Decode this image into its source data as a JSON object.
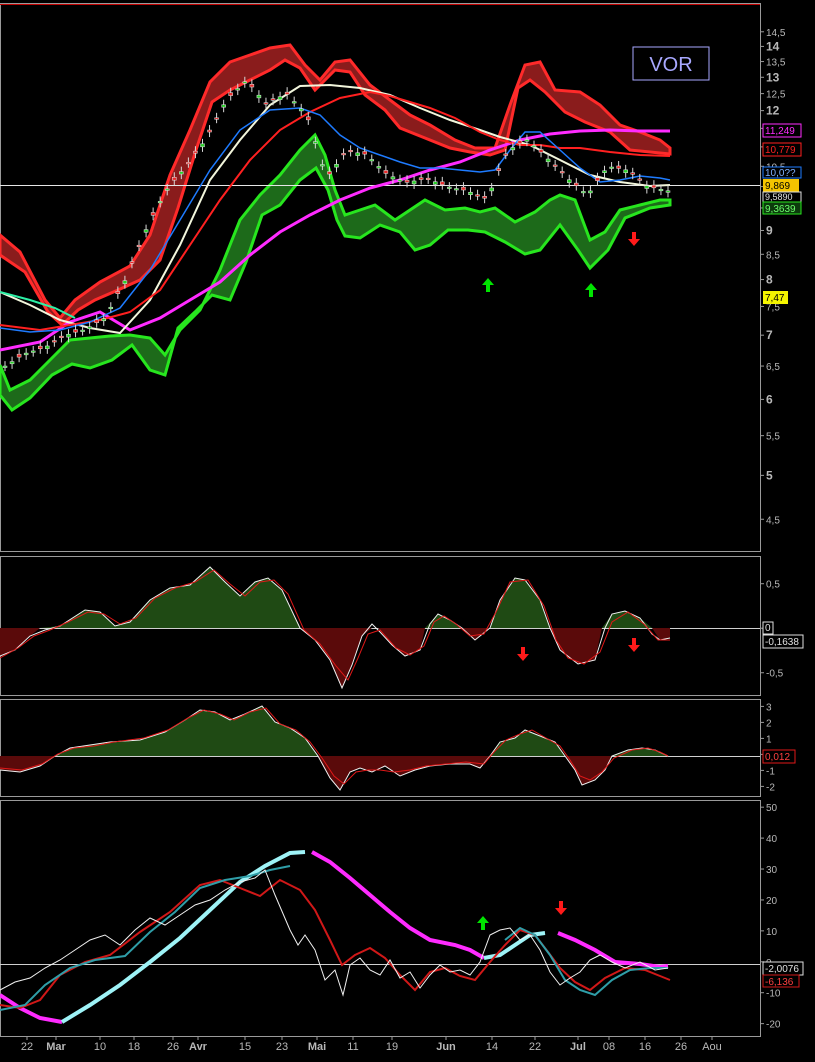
{
  "symbol": "VOR",
  "x_axis": {
    "labels": [
      "22",
      "Mar",
      "10",
      "18",
      "26",
      "Avr",
      "15",
      "23",
      "Mai",
      "11",
      "19",
      "Jun",
      "14",
      "22",
      "Jul",
      "08",
      "16",
      "26",
      "Aou"
    ],
    "bold": [
      "Mar",
      "Avr",
      "Mai",
      "Jun",
      "Jul"
    ]
  },
  "colors": {
    "bull": "#1f4a14",
    "bear": "#5a0a0a",
    "band_red": "#ff2a2a",
    "band_green": "#27e61e",
    "magenta": "#ff2bff",
    "cyan": "#9ef3f7"
  },
  "chart_data": [
    {
      "type": "line",
      "title": "VOR",
      "y_ticks": [
        "14,5",
        "14",
        "13,5",
        "13",
        "12,5",
        "12",
        "11,5",
        "11",
        "10,5",
        "10",
        "9,5",
        "9",
        "8,5",
        "8",
        "7,5",
        "7",
        "6,5",
        "6",
        "5,5",
        "5",
        "4,5"
      ],
      "ylim": [
        4.2,
        15.5
      ],
      "y_scale": "log",
      "value_labels": [
        {
          "text": "11,249",
          "kind": "magenta"
        },
        {
          "text": "10,779",
          "kind": "red"
        },
        {
          "text": "10,0??",
          "kind": "blue"
        },
        {
          "text": "9,869",
          "kind": "price"
        },
        {
          "text": "9,5890",
          "kind": "white"
        },
        {
          "text": "9,3639",
          "kind": "green"
        },
        {
          "text": "7,47",
          "kind": "yellow"
        }
      ],
      "series": [
        {
          "role": "close",
          "values": [
            6.5,
            6.7,
            6.8,
            7.0,
            7.1,
            7.3,
            8.0,
            9.0,
            9.9,
            10.5,
            11.2,
            12.3,
            12.9,
            12.2,
            12.5,
            11.9,
            10.2,
            10.9,
            10.8,
            10.3,
            10.1,
            10.2,
            10.0,
            9.9,
            9.7,
            10.9,
            11.2,
            10.7,
            10.2,
            9.8,
            10.5,
            10.4,
            10.0,
            9.9
          ]
        },
        {
          "role": "ma_blue",
          "values": [
            6.5,
            6.7,
            6.9,
            7.1,
            7.3,
            7.8,
            8.6,
            9.4,
            10.2,
            10.9,
            11.6,
            12.0,
            12.0,
            11.6,
            11.0,
            10.6,
            10.4,
            10.2,
            10.0,
            9.8,
            9.9,
            10.3,
            10.6,
            10.4,
            10.0,
            9.9,
            9.95,
            9.95
          ]
        },
        {
          "role": "ma_red",
          "values": [
            6.8,
            7.0,
            7.2,
            7.4,
            7.8,
            8.4,
            9.2,
            10.1,
            10.9,
            11.5,
            11.9,
            11.8,
            11.4,
            11.0,
            10.7,
            10.5,
            10.5,
            10.8,
            11.0,
            10.9,
            10.6
          ]
        },
        {
          "role": "ma_white",
          "values": [
            7.2,
            7.0,
            7.0,
            7.3,
            7.9,
            8.8,
            9.8,
            10.7,
            11.4,
            11.9,
            12.0,
            11.8,
            11.4,
            11.0,
            10.6,
            10.2,
            9.9,
            9.75,
            9.7,
            9.7
          ]
        },
        {
          "role": "ma_magenta",
          "values": [
            7.0,
            6.95,
            7.0,
            7.3,
            7.7,
            8.2,
            8.8,
            9.3,
            9.7,
            10.0,
            10.3,
            10.6,
            10.9,
            11.1,
            11.2,
            11.2,
            11.25
          ]
        }
      ]
    },
    {
      "type": "area",
      "y_ticks": [
        "0,5",
        "0",
        "-0,5"
      ],
      "ylim": [
        -0.75,
        0.8
      ],
      "value_labels": [
        "0",
        "-0,1638"
      ],
      "values": [
        -0.25,
        -0.1,
        0.0,
        0.18,
        0.05,
        0.4,
        0.6,
        0.48,
        0.55,
        0.2,
        -0.2,
        -0.55,
        0.0,
        -0.25,
        -0.3,
        0.1,
        -0.05,
        -0.15,
        0.5,
        0.1,
        -0.3,
        -0.35,
        0.15,
        0.1,
        -0.16
      ]
    },
    {
      "type": "area",
      "y_ticks": [
        "3",
        "2",
        "1",
        "0",
        "-1",
        "-2"
      ],
      "ylim": [
        -2.6,
        3.4
      ],
      "value_labels": [
        "0,012"
      ],
      "values": [
        -0.8,
        -0.9,
        0.3,
        0.7,
        0.6,
        1.2,
        2.3,
        3.0,
        2.1,
        1.3,
        -1.0,
        -2.0,
        -1.0,
        -0.5,
        -0.2,
        -0.4,
        0.5,
        1.2,
        2.0,
        1.0,
        -0.9,
        -1.8,
        -0.5,
        0.1,
        0.6,
        0.3,
        0.01
      ]
    },
    {
      "type": "line",
      "y_ticks": [
        "50",
        "40",
        "30",
        "20",
        "10",
        "0",
        "-10",
        "-20"
      ],
      "ylim": [
        -24,
        52
      ],
      "value_labels": [
        "-2,0076",
        "-6,136"
      ],
      "series": [
        {
          "role": "oscillator",
          "values": [
            -10,
            -20,
            -20,
            -12,
            0,
            10,
            22,
            32,
            38,
            40,
            38,
            32,
            24,
            16,
            10,
            7,
            4,
            0,
            -2,
            2,
            10,
            9,
            6,
            0,
            -2,
            -4
          ]
        },
        {
          "role": "signal",
          "values": [
            -12,
            -14,
            -6,
            4,
            10,
            20,
            28,
            30,
            22,
            2,
            -4,
            -5,
            -5,
            -8,
            -4,
            10,
            12,
            0,
            -10,
            -2,
            -4,
            -6
          ]
        },
        {
          "role": "fast",
          "values": [
            -10,
            -5,
            3,
            8,
            14,
            20,
            25,
            32,
            37,
            25,
            -10,
            0,
            -5,
            2,
            -8,
            -3,
            0,
            -5,
            12,
            3,
            -10,
            -2,
            1,
            -3,
            -5
          ]
        }
      ]
    }
  ]
}
